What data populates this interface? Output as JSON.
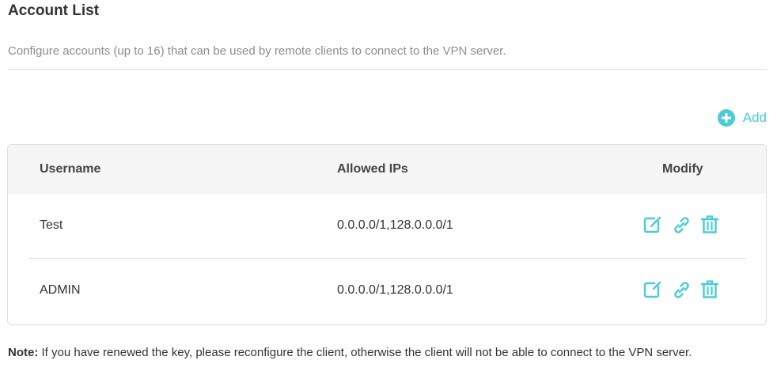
{
  "section": {
    "title": "Account List",
    "description": "Configure accounts (up to 16) that can be used by remote clients to connect to the VPN server."
  },
  "toolbar": {
    "add_label": "Add",
    "add_icon": "plus-circle-icon"
  },
  "table": {
    "columns": [
      "Username",
      "Allowed IPs",
      "Modify"
    ],
    "rows": [
      {
        "username": "Test",
        "allowed_ips": "0.0.0.0/1,128.0.0.0/1"
      },
      {
        "username": "ADMIN",
        "allowed_ips": "0.0.0.0/1,128.0.0.0/1"
      }
    ],
    "row_actions": [
      "edit-icon",
      "link-icon",
      "trash-icon"
    ]
  },
  "note": {
    "label": "Note:",
    "text": " If you have renewed the key, please reconfigure the client, otherwise the client will not be able to connect to the VPN server."
  },
  "colors": {
    "accent": "#4acbd6",
    "header_bg": "#f5f5f5",
    "muted_text": "#8c8c8c"
  }
}
